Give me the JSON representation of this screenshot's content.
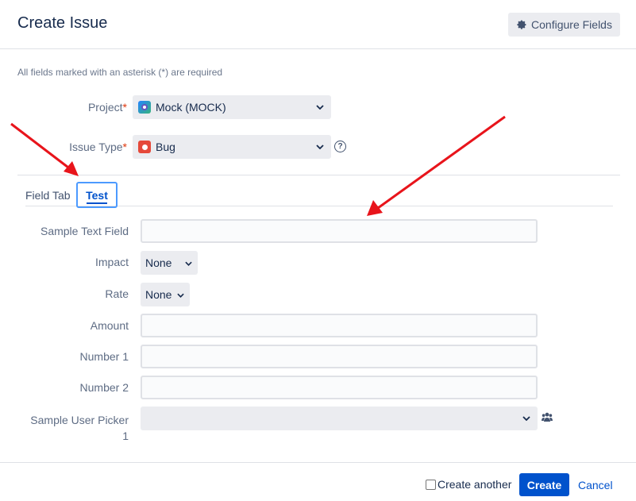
{
  "dialog": {
    "title": "Create Issue",
    "configure_fields_label": "Configure Fields",
    "required_note": "All fields marked with an asterisk (*) are required"
  },
  "project": {
    "label": "Project",
    "required_mark": "*",
    "value": "Mock (MOCK)"
  },
  "issue_type": {
    "label": "Issue Type",
    "required_mark": "*",
    "value": "Bug",
    "help": "?"
  },
  "tabs": [
    {
      "label": "Field Tab",
      "active": false
    },
    {
      "label": "Test",
      "active": true
    }
  ],
  "fields": {
    "sample_text_field": {
      "label": "Sample Text Field",
      "value": ""
    },
    "impact": {
      "label": "Impact",
      "value": "None"
    },
    "rate": {
      "label": "Rate",
      "value": "None"
    },
    "amount": {
      "label": "Amount",
      "value": ""
    },
    "number_1": {
      "label": "Number 1",
      "value": ""
    },
    "number_2": {
      "label": "Number 2",
      "value": ""
    },
    "sample_user_picker_1": {
      "label_line1": "Sample User Picker",
      "label_line2": "1",
      "value": ""
    }
  },
  "footer": {
    "create_another_label": "Create another",
    "create_another_checked": false,
    "create_label": "Create",
    "cancel_label": "Cancel"
  },
  "colors": {
    "primary": "#0052cc",
    "focus_ring": "#4c9aff",
    "required": "#de350b",
    "annotation_arrow": "#e8141b"
  },
  "icons": [
    "gear-icon",
    "project-avatar-icon",
    "bug-icon",
    "help-icon",
    "chevron-down-icon",
    "users-icon"
  ]
}
